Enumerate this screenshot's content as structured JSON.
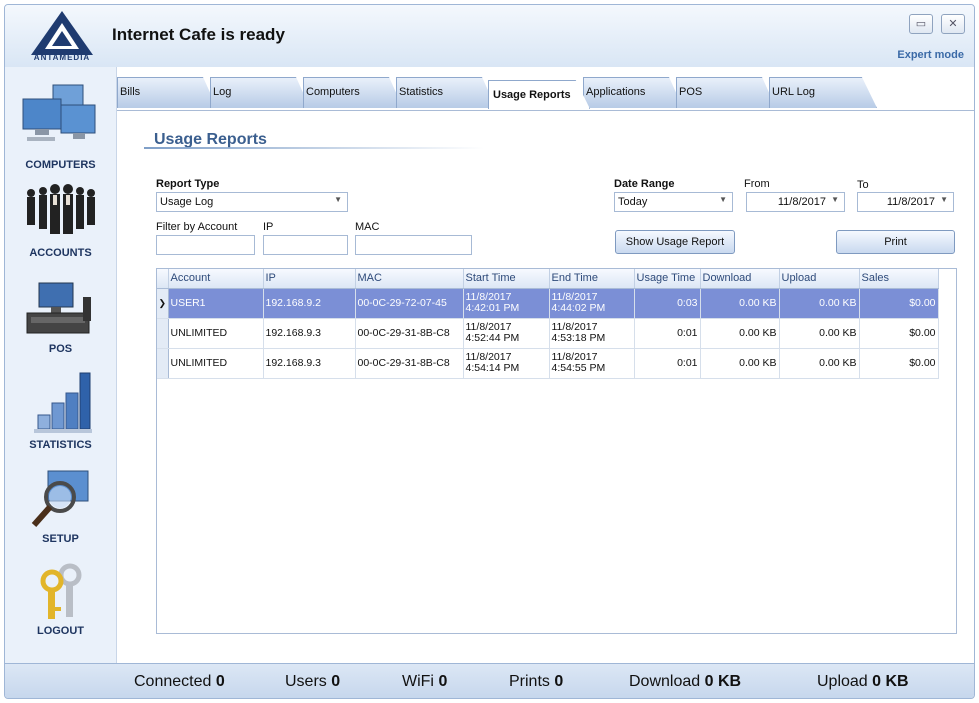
{
  "app": {
    "title": "Internet Cafe is ready",
    "logo_text": "ANTAMEDIA",
    "expert_mode": "Expert mode",
    "minimize": "▭",
    "close": "✕"
  },
  "sidebar": {
    "items": [
      {
        "label": "COMPUTERS",
        "icon": "computers-icon"
      },
      {
        "label": "ACCOUNTS",
        "icon": "accounts-icon"
      },
      {
        "label": "POS",
        "icon": "pos-icon"
      },
      {
        "label": "STATISTICS",
        "icon": "statistics-icon"
      },
      {
        "label": "SETUP",
        "icon": "setup-icon"
      },
      {
        "label": "LOGOUT",
        "icon": "logout-icon"
      }
    ]
  },
  "tabs": [
    {
      "label": "Bills"
    },
    {
      "label": "Log"
    },
    {
      "label": "Computers"
    },
    {
      "label": "Statistics"
    },
    {
      "label": "Usage Reports",
      "active": true
    },
    {
      "label": "Applications"
    },
    {
      "label": "POS"
    },
    {
      "label": "URL Log"
    }
  ],
  "page": {
    "title": "Usage Reports",
    "report_type_label": "Report Type",
    "report_type_value": "Usage Log",
    "filter_account_label": "Filter by Account",
    "ip_label": "IP",
    "mac_label": "MAC",
    "date_range_label": "Date Range",
    "date_range_value": "Today",
    "from_label": "From",
    "from_value": "11/8/2017",
    "to_label": "To",
    "to_value": "11/8/2017",
    "show_button": "Show Usage Report",
    "print_button": "Print"
  },
  "grid": {
    "columns": [
      "Account",
      "IP",
      "MAC",
      "Start Time",
      "End Time",
      "Usage Time",
      "Download",
      "Upload",
      "Sales"
    ],
    "rows": [
      {
        "account": "USER1",
        "ip": "192.168.9.2",
        "mac": "00-0C-29-72-07-45",
        "start_date": "11/8/2017",
        "start_time": "4:42:01 PM",
        "end_date": "11/8/2017",
        "end_time": "4:44:02 PM",
        "usage": "0:03",
        "download": "0.00 KB",
        "upload": "0.00 KB",
        "sales": "$0.00",
        "selected": true
      },
      {
        "account": "UNLIMITED",
        "ip": "192.168.9.3",
        "mac": "00-0C-29-31-8B-C8",
        "start_date": "11/8/2017",
        "start_time": "4:52:44 PM",
        "end_date": "11/8/2017",
        "end_time": "4:53:18 PM",
        "usage": "0:01",
        "download": "0.00 KB",
        "upload": "0.00 KB",
        "sales": "$0.00"
      },
      {
        "account": "UNLIMITED",
        "ip": "192.168.9.3",
        "mac": "00-0C-29-31-8B-C8",
        "start_date": "11/8/2017",
        "start_time": "4:54:14 PM",
        "end_date": "11/8/2017",
        "end_time": "4:54:55 PM",
        "usage": "0:01",
        "download": "0.00 KB",
        "upload": "0.00 KB",
        "sales": "$0.00"
      }
    ]
  },
  "status": {
    "connected_label": "Connected",
    "connected_value": "0",
    "users_label": "Users",
    "users_value": "0",
    "wifi_label": "WiFi",
    "wifi_value": "0",
    "prints_label": "Prints",
    "prints_value": "0",
    "download_label": "Download",
    "download_value": "0 KB",
    "upload_label": "Upload",
    "upload_value": "0 KB"
  }
}
